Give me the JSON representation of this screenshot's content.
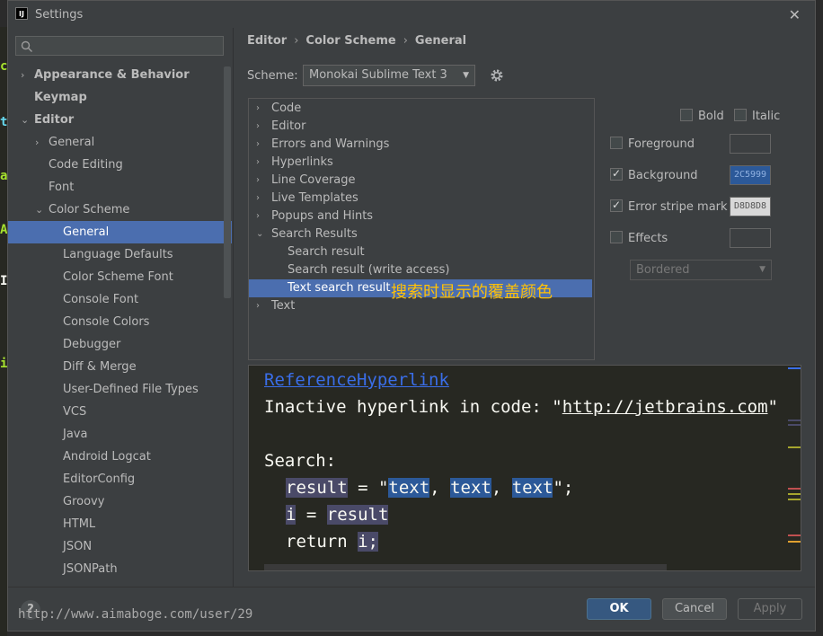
{
  "window": {
    "title": "Settings",
    "app_icon": "IJ"
  },
  "sidebar": {
    "search_placeholder": "",
    "items": [
      {
        "label": "Appearance & Behavior",
        "arrow": "›",
        "bold": true
      },
      {
        "label": "Keymap",
        "bold": true
      },
      {
        "label": "Editor",
        "arrow": "⌄",
        "bold": true
      },
      {
        "label": "General",
        "arrow": "›"
      },
      {
        "label": "Code Editing"
      },
      {
        "label": "Font"
      },
      {
        "label": "Color Scheme",
        "arrow": "⌄"
      },
      {
        "label": "General",
        "selected": true
      },
      {
        "label": "Language Defaults"
      },
      {
        "label": "Color Scheme Font"
      },
      {
        "label": "Console Font"
      },
      {
        "label": "Console Colors"
      },
      {
        "label": "Debugger"
      },
      {
        "label": "Diff & Merge"
      },
      {
        "label": "User-Defined File Types"
      },
      {
        "label": "VCS"
      },
      {
        "label": "Java"
      },
      {
        "label": "Android Logcat"
      },
      {
        "label": "EditorConfig"
      },
      {
        "label": "Groovy"
      },
      {
        "label": "HTML"
      },
      {
        "label": "JSON"
      },
      {
        "label": "JSONPath"
      }
    ]
  },
  "breadcrumb": {
    "items": [
      "Editor",
      "Color Scheme",
      "General"
    ],
    "separator": "›"
  },
  "scheme": {
    "label": "Scheme:",
    "value": "Monokai Sublime Text 3"
  },
  "options_tree": {
    "items": [
      {
        "label": "Code",
        "arrow": "›"
      },
      {
        "label": "Editor",
        "arrow": "›"
      },
      {
        "label": "Errors and Warnings",
        "arrow": "›"
      },
      {
        "label": "Hyperlinks",
        "arrow": "›"
      },
      {
        "label": "Line Coverage",
        "arrow": "›"
      },
      {
        "label": "Live Templates",
        "arrow": "›"
      },
      {
        "label": "Popups and Hints",
        "arrow": "›"
      },
      {
        "label": "Search Results",
        "arrow": "⌄"
      },
      {
        "label": "Search result"
      },
      {
        "label": "Search result (write access)"
      },
      {
        "label": "Text search result",
        "selected": true
      },
      {
        "label": "Text",
        "arrow": "›"
      }
    ],
    "annotation": "搜索时显示的覆盖颜色"
  },
  "attributes": {
    "bold_label": "Bold",
    "italic_label": "Italic",
    "foreground_label": "Foreground",
    "background_label": "Background",
    "background_value": "2C5999",
    "background_color": "#2c5999",
    "error_stripe_label": "Error stripe mark",
    "error_stripe_value": "D8D8D8",
    "error_stripe_color": "#d8d8d8",
    "effects_label": "Effects",
    "effects_type": "Bordered"
  },
  "preview": {
    "ref_hyperlink": "ReferenceHyperlink",
    "inactive_prefix": "Inactive hyperlink in code: \"",
    "inactive_url": "http://jetbrains.com",
    "inactive_suffix": "\"",
    "search_label": "Search:",
    "line_result_lhs": "result",
    "line_result_eq": " = \"",
    "word_text": "text",
    "comma": ", ",
    "line_end": "\";",
    "line_i": "i",
    "line_i_eq": " = ",
    "line_result_rhs": "result",
    "line_return": "return ",
    "line_return_i": "i;"
  },
  "footer": {
    "help_label": "?",
    "watermark": "http://www.aimaboge.com/user/29",
    "ok_label": "OK",
    "cancel_label": "Cancel",
    "apply_label": "Apply"
  }
}
